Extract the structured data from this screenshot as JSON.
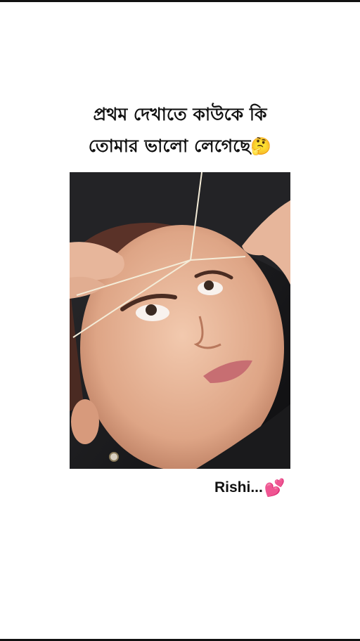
{
  "caption": {
    "line1": "প্রথম দেখাতে কাউকে কি",
    "line2": "তোমার ভালো লেগেছে",
    "emoji": "🤔"
  },
  "photo": {
    "subject": "woman-eyebrow-threading-photo"
  },
  "signature": {
    "text": "Rishi...",
    "emoji": "💕"
  },
  "colors": {
    "background": "#ffffff",
    "text": "#111111"
  }
}
